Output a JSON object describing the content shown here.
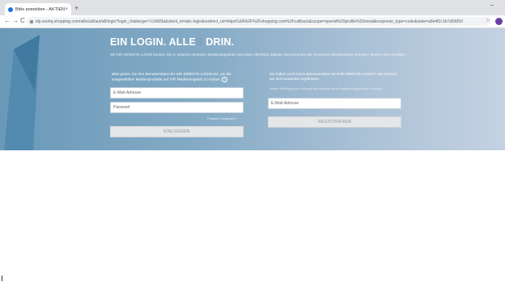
{
  "browser": {
    "tab_title": "Bitte anmelden - AKTIEN ONLINE",
    "tab_close": "×",
    "new_tab": "+",
    "window_control": "–",
    "back": "←",
    "forward": "→",
    "reload": "C",
    "url": "idp.ssohq.shopping.com/a8/e/a8/aut/a8/login?login_challenge=7c2d9f3a&client_id=abc-login&redirect_uri=https%3A%2F%2Fshopping.com%2Fcallback&scope=openid%20profile%20email&response_type=code&state=a8e4f2c1b7d93050",
    "bookmark": "☆"
  },
  "hero": {
    "headline_part1": "EIN LOGIN. ALLE",
    "headline_highlight": "S",
    "headline_part2": " DRIN.",
    "intro": "Mit IHR DIREKTE LOGIN können Sie in unseren zentralen Medienangebote und einen Überblick digitale Abonnements der deutschen Mittelpunktes anzeigen lassen und verwalten."
  },
  "login": {
    "description": "Bitte geben Sie Ihre Benutzerdaten für IHR DIREKTE LOGIN ein, um die ausgewählten Medienprodukte auf IHR Medienangebot zu nutzen.",
    "email_placeholder": "E-Mail-Adresse",
    "password_placeholder": "Passwort",
    "forgot_link": "Passwort vergessen?",
    "submit_label": "EINLOGGEN"
  },
  "register": {
    "description": "Sie haben noch keine Benutzerdaten bei IHR DIREKTE LOGIN? Hier können Sie sich kostenlos registrieren.",
    "note": "Unsere Einwilligung zur Nutzung aller Angebote ist im Registrierungsprozess hinterlegt.",
    "email_placeholder": "E-Mail-Adresse",
    "submit_label": "REGISTRIEREN"
  },
  "colors": {
    "hero_left": "#6a99b8",
    "hero_right": "#c4d2e2",
    "accent_text": "#7f9fb9",
    "button_bg": "#e4e6e8",
    "profile": "#6b3fa0"
  },
  "icons": {
    "help": "?"
  }
}
